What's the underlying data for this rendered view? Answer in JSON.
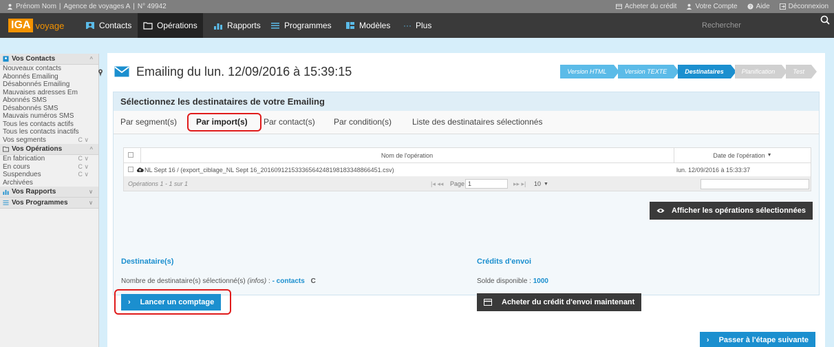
{
  "topbar": {
    "user": "Prénom Nom",
    "agency": "Agence de voyages A",
    "account_no": "N° 49942",
    "buy_credit": "Acheter du crédit",
    "account": "Votre Compte",
    "help": "Aide",
    "logout": "Déconnexion"
  },
  "nav": {
    "logo_badge": "IGA",
    "logo_word": "voyage",
    "contacts": "Contacts",
    "operations": "Opérations",
    "rapports": "Rapports",
    "programmes": "Programmes",
    "modeles": "Modèles",
    "plus": "Plus",
    "search_placeholder": "Rechercher"
  },
  "sidebar": {
    "contacts_title": "Vos Contacts",
    "contacts_items": [
      "Nouveaux contacts",
      "Abonnés Emailing",
      "Désabonnés Emailing",
      "Mauvaises adresses Em",
      "Abonnés SMS",
      "Désabonnés SMS",
      "Mauvais numéros SMS",
      "Tous les contacts actifs",
      "Tous les contacts inactifs",
      "Vos segments"
    ],
    "operations_title": "Vos Opérations",
    "operations_items": [
      "En fabrication",
      "En cours",
      "Suspendues",
      "Archivées"
    ],
    "rapports_title": "Vos Rapports",
    "programmes_title": "Vos Programmes"
  },
  "main": {
    "title": "Emailing du lun. 12/09/2016 à 15:39:15",
    "steps": [
      "Version HTML",
      "Version TEXTE",
      "Destinataires",
      "Planification",
      "Test"
    ],
    "select_header": "Sélectionnez les destinataires de votre Emailing",
    "tabs": [
      "Par segment(s)",
      "Par import(s)",
      "Par contact(s)",
      "Par condition(s)",
      "Liste des destinataires sélectionnés"
    ],
    "grid": {
      "col_name": "Nom de l'opération",
      "col_date": "Date de l'opération",
      "row_name": "NL Sept 16 / (export_ciblage_NL Sept 16_20160912153336564248198183348866451.csv)",
      "row_date": "lun. 12/09/2016 à 15:33:37",
      "pager_info": "Opérations 1 - 1 sur 1",
      "page_label": "Page",
      "page_value": "1",
      "per_page": "10"
    },
    "show_selected_button": "Afficher les opérations sélectionnées",
    "recipients_title": "Destinataire(s)",
    "recipients_line_prefix": "Nombre de destinataire(s) sélectionné(s)",
    "recipients_infos": "(infos)",
    "recipients_dash_contacts": "- contacts",
    "count_button": "Lancer un comptage",
    "credits_title": "Crédits d'envoi",
    "balance_label": "Solde disponible",
    "balance_value": "1000",
    "buy_credit_button": "Acheter du crédit d'envoi maintenant",
    "next_button": "Passer à l'étape suivante"
  },
  "colors": {
    "accent": "#1b8fcf",
    "logo": "#f39200",
    "highlight": "#e01c1c",
    "navbar": "#3a3a3a"
  }
}
